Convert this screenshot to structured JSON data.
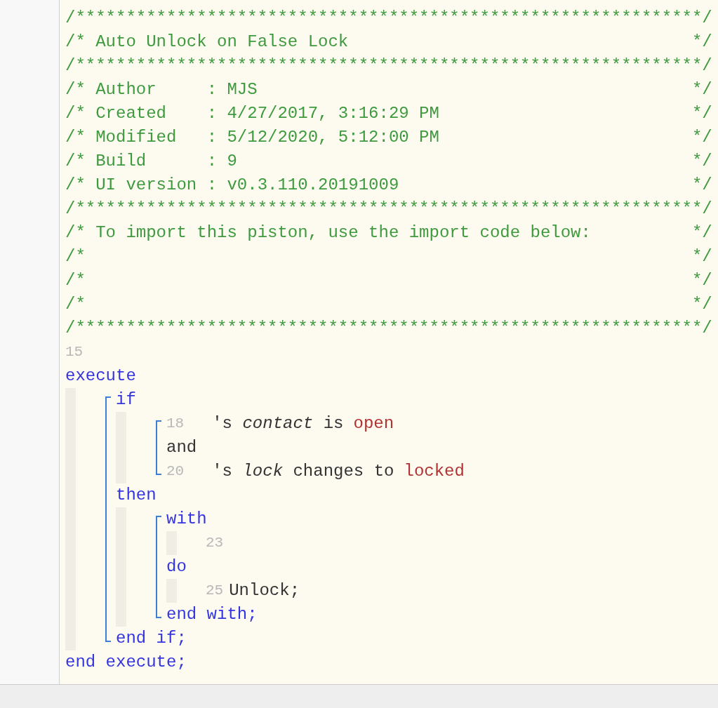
{
  "header_comment": [
    {
      "text": "/**************************************************************/"
    },
    {
      "text": "/* Auto Unlock on False Lock",
      "end": "*/"
    },
    {
      "text": "/**************************************************************/"
    },
    {
      "text": "/* Author     : MJS",
      "end": "*/"
    },
    {
      "text": "/* Created    : 4/27/2017, 3:16:29 PM",
      "end": "*/"
    },
    {
      "text": "/* Modified   : 5/12/2020, 5:12:00 PM",
      "end": "*/"
    },
    {
      "text": "/* Build      : 9",
      "end": "*/"
    },
    {
      "text": "/* UI version : v0.3.110.20191009",
      "end": "*/"
    },
    {
      "text": "/**************************************************************/"
    },
    {
      "text": "/* To import this piston, use the import code below:",
      "end": "*/"
    },
    {
      "text": "/*",
      "end": "*/"
    },
    {
      "text": "/*",
      "end": "*/"
    },
    {
      "text": "/*",
      "end": "*/"
    },
    {
      "text": "/**************************************************************/"
    }
  ],
  "blank_line_number": "15",
  "program": {
    "kind": "block",
    "bracket": false,
    "header": "execute",
    "sections": [
      {
        "children": [
          {
            "kind": "block",
            "bracket": true,
            "header": "if",
            "sections": [
              {
                "children": [
                  {
                    "kind": "group",
                    "bracket": true,
                    "children": [
                      {
                        "kind": "condition",
                        "number": "18",
                        "text": "'s *contact* is",
                        "value": "open"
                      },
                      {
                        "kind": "operator",
                        "text": "and"
                      },
                      {
                        "kind": "condition",
                        "number": "20",
                        "text": "'s *lock* changes to",
                        "value": "locked"
                      }
                    ]
                  }
                ]
              },
              {
                "label": "then",
                "children": [
                  {
                    "kind": "block",
                    "bracket": true,
                    "header": "with",
                    "sections": [
                      {
                        "children": [
                          {
                            "kind": "statement",
                            "number": "23"
                          }
                        ]
                      },
                      {
                        "label": "do",
                        "children": [
                          {
                            "kind": "statement",
                            "number": "25",
                            "text": "Unlock;"
                          }
                        ]
                      }
                    ],
                    "footer": "end with;"
                  }
                ]
              }
            ],
            "footer": "end if;"
          }
        ]
      }
    ],
    "footer": "end execute;"
  }
}
